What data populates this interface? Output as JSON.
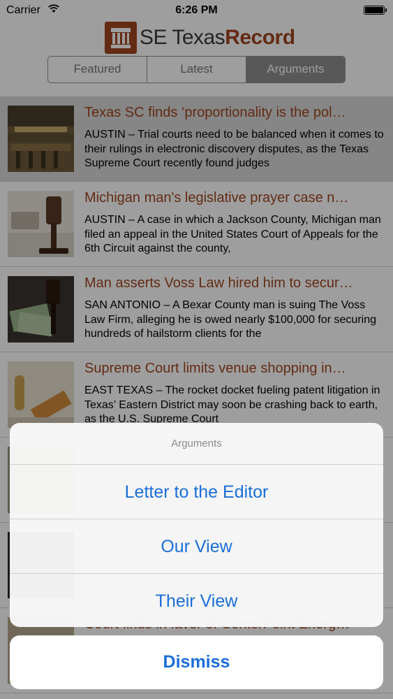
{
  "status_bar": {
    "carrier": "Carrier",
    "time": "6:26 PM"
  },
  "header": {
    "logo_text_plain": "SE Texas",
    "logo_text_bold": "Record",
    "tabs": [
      {
        "label": "Featured"
      },
      {
        "label": "Latest"
      },
      {
        "label": "Arguments"
      }
    ],
    "active_tab": "Arguments"
  },
  "articles": [
    {
      "title": "Texas SC finds ‘proportionality is the pol…",
      "summary": "AUSTIN – Trial courts need to be balanced when it comes to their rulings in electronic discovery disputes, as the Texas Supreme Court recently found judges",
      "thumb_icon": "courtroom-image"
    },
    {
      "title": "Michigan man's legislative prayer case n…",
      "summary": "AUSTIN – A case in which a Jackson County, Michigan man filed an appeal in the United States Court of Appeals for the 6th Circuit against the county,",
      "thumb_icon": "gavel-image"
    },
    {
      "title": "Man asserts Voss Law hired him to secur…",
      "summary": "SAN ANTONIO – A Bexar County man is suing The Voss Law Firm, alleging he is owed nearly $100,000 for securing hundreds of hailstorm clients for the",
      "thumb_icon": "gavel-money-image"
    },
    {
      "title": "Supreme Court limits venue shopping in…",
      "summary": "EAST TEXAS – The rocket docket fueling patent litigation in Texas’ Eastern District may soon be crashing back to earth, as the U.S. Supreme Court",
      "thumb_icon": "stamp-image"
    },
    {
      "title": "",
      "summary": "",
      "thumb_icon": "article-image"
    },
    {
      "title": "",
      "summary": "",
      "thumb_icon": "article-image"
    },
    {
      "title": "Court finds in favor of CenterPoint Energ…",
      "summary": "",
      "thumb_icon": "article-image"
    }
  ],
  "action_sheet": {
    "title": "Arguments",
    "options": [
      "Letter to the Editor",
      "Our View",
      "Their View"
    ],
    "dismiss_label": "Dismiss"
  },
  "colors": {
    "brand": "#a0461f",
    "action_blue": "#1a6ed8",
    "segment_active": "#8f8f8f"
  }
}
